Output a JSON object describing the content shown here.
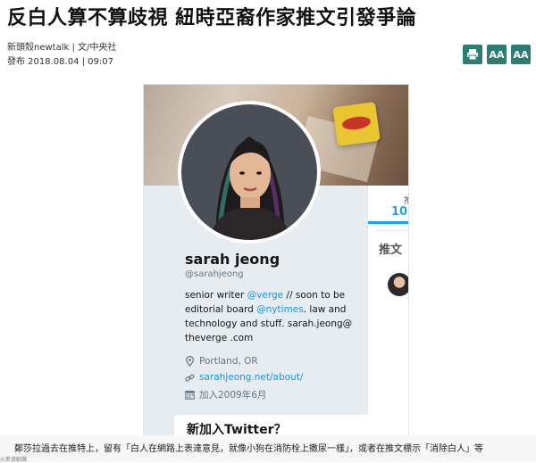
{
  "article": {
    "headline": "反白人算不算歧視 紐時亞裔作家推文引發爭論",
    "source": "新頭殼newtalk | 文/中央社",
    "published": "發布 2018.08.04 | 09:07"
  },
  "tools": [
    {
      "name": "print-button",
      "icon": "printer-icon",
      "label": ""
    },
    {
      "name": "font-smaller-button",
      "icon": "font-size-icon",
      "label": "AA"
    },
    {
      "name": "font-larger-button",
      "icon": "font-size-icon",
      "label": "AA"
    }
  ],
  "profile": {
    "name": "sarah jeong",
    "handle": "@sarahjeong",
    "bio_parts": [
      "senior writer ",
      "@verge",
      " // soon to be editorial board ",
      "@nytimes",
      ". law and technology and stuff. sarah.jeong@ theverge .com"
    ],
    "location": "Portland, OR",
    "website": "sarahjeong.net/about/",
    "joined": "加入2009年6月"
  },
  "side": {
    "stat_label": "推",
    "stat_value": "10.",
    "pane_heading": "推文"
  },
  "card_heading": "新加入Twitter？",
  "caption": {
    "text": "鄭莎拉過去在推特上，留有「白人在網路上表達意見，就像小狗在消防栓上撒尿一樣」，或者在推文標示「消除白人」等",
    "sub": "元素據翻攝"
  },
  "colors": {
    "accent": "#2e7d74",
    "twitter_blue": "#1da1f2",
    "link": "#1b95e0"
  }
}
